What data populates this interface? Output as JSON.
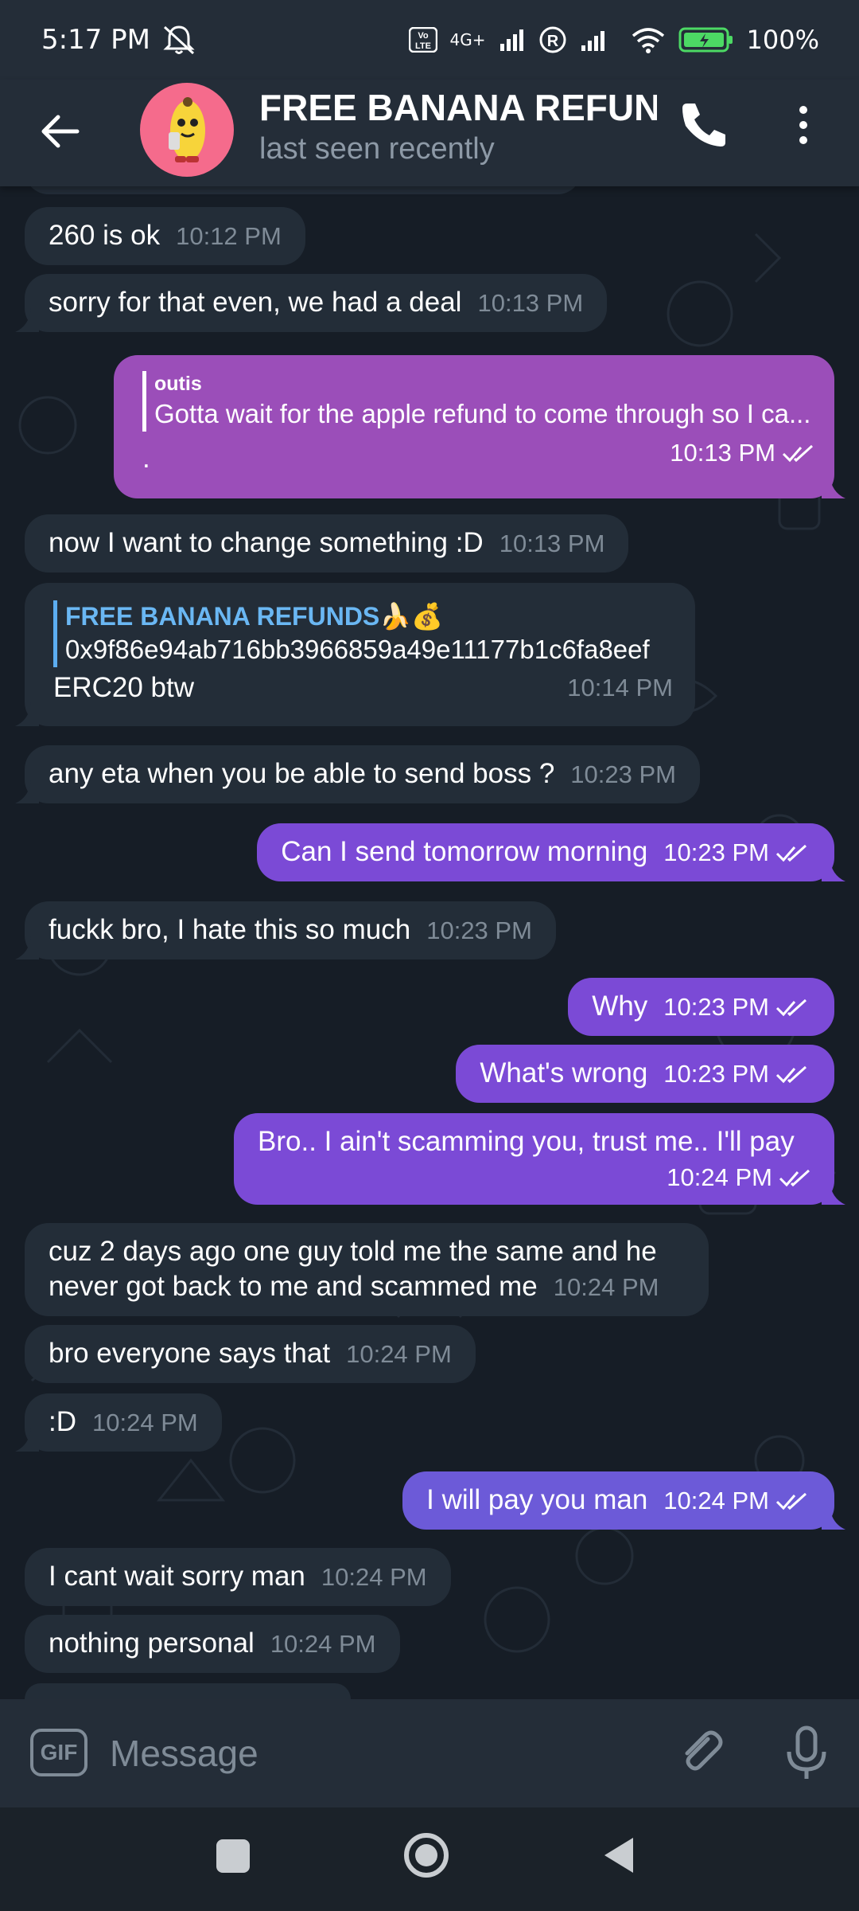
{
  "status_bar": {
    "time": "5:17 PM",
    "network_label": "4G+",
    "battery": "100%"
  },
  "header": {
    "title": "FREE BANANA REFUN",
    "subtitle": "last seen recently",
    "icons": [
      "back-arrow-icon",
      "phone-icon",
      "more-vertical-icon"
    ]
  },
  "messages": [
    {
      "dir": "in",
      "text": "260 is ok",
      "time": "10:12 PM"
    },
    {
      "dir": "in",
      "text": "sorry for that even, we had a deal",
      "time": "10:13 PM"
    },
    {
      "dir": "out",
      "reply_name": "outis",
      "reply_text": "Gotta wait for the apple refund to come through so I ca...",
      "text": ".",
      "time": "10:13 PM"
    },
    {
      "dir": "in",
      "text": "now I want to change something :D",
      "time": "10:13 PM"
    },
    {
      "dir": "in",
      "reply_name": "FREE BANANA REFUNDS🍌💰",
      "reply_text": "0x9f86e94ab716bb3966859a49e11177b1c6fa8eef",
      "text": "ERC20 btw",
      "time": "10:14 PM"
    },
    {
      "dir": "in",
      "text": "any eta when you be able to send boss ?",
      "time": "10:23 PM"
    },
    {
      "dir": "out",
      "text": "Can I send tomorrow morning",
      "time": "10:23 PM"
    },
    {
      "dir": "in",
      "text": "fuckk bro, I hate this so much",
      "time": "10:23 PM"
    },
    {
      "dir": "out",
      "text": "Why",
      "time": "10:23 PM"
    },
    {
      "dir": "out",
      "text": "What's wrong",
      "time": "10:23 PM"
    },
    {
      "dir": "out",
      "text": "Bro.. I ain't scamming you, trust me.. I'll pay",
      "time": "10:24 PM"
    },
    {
      "dir": "in",
      "text_line1": "cuz 2 days ago one guy told me the same and he",
      "text_line2": "never got back to me and scammed me",
      "time": "10:24 PM"
    },
    {
      "dir": "in",
      "text": "bro everyone says that",
      "time": "10:24 PM"
    },
    {
      "dir": "in",
      "text": ":D",
      "time": "10:24 PM"
    },
    {
      "dir": "out",
      "text": "I will pay you man",
      "time": "10:24 PM"
    },
    {
      "dir": "in",
      "text": "I cant wait sorry man",
      "time": "10:24 PM"
    },
    {
      "dir": "in",
      "text": "nothing personal",
      "time": "10:24 PM"
    }
  ],
  "input": {
    "placeholder": "Message",
    "gif_label": "GIF"
  },
  "colors": {
    "incoming_bubble": "#232d38",
    "outgoing_bubble": "#7b4ad6",
    "header_bg": "#242d38",
    "time_gray": "#7f8b97"
  }
}
